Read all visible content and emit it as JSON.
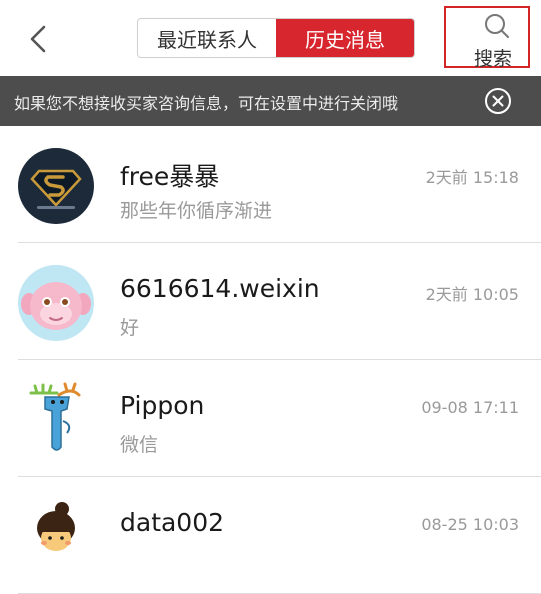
{
  "header": {
    "tabs": [
      {
        "label": "最近联系人",
        "active": false
      },
      {
        "label": "历史消息",
        "active": true
      }
    ],
    "search_label": "搜索",
    "accent_color": "#d8262f"
  },
  "notice": {
    "text": "如果您不想接收买家咨询信息，可在设置中进行关闭哦"
  },
  "conversations": [
    {
      "name": "free暴暴",
      "preview": "那些年你循序渐进",
      "time": "2天前 15:18",
      "avatar_icon": "superman-logo-icon"
    },
    {
      "name": "6616614.weixin",
      "preview": "好",
      "time": "2天前 10:05",
      "avatar_icon": "pink-monkey-avatar-icon"
    },
    {
      "name": "Pippon",
      "preview": "微信",
      "time": "09-08 17:11",
      "avatar_icon": "blue-moose-avatar-icon"
    },
    {
      "name": "data002",
      "preview": "",
      "time": "08-25 10:03",
      "avatar_icon": "cartoon-girl-avatar-icon"
    }
  ]
}
